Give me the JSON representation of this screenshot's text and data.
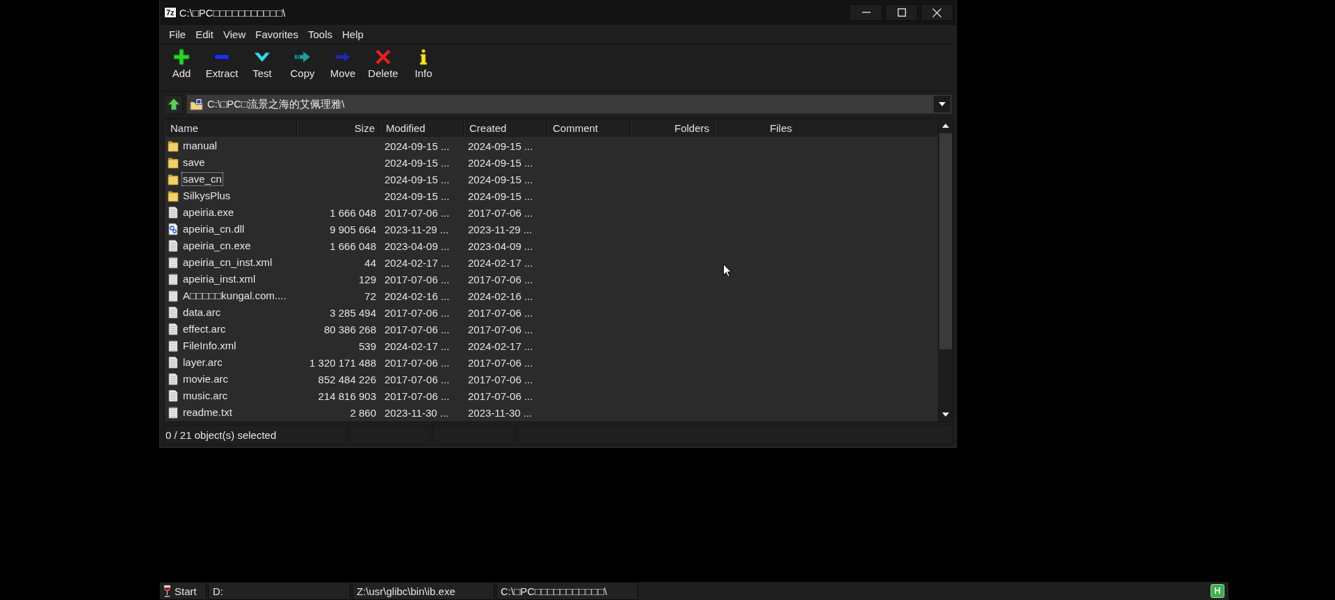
{
  "window": {
    "logo": "7z",
    "title": "C:\\□PC□□□□□□□□□□□\\"
  },
  "menu": [
    {
      "label": "File"
    },
    {
      "label": "Edit"
    },
    {
      "label": "View"
    },
    {
      "label": "Favorites"
    },
    {
      "label": "Tools"
    },
    {
      "label": "Help"
    }
  ],
  "toolbar": [
    {
      "kind": "add",
      "label": "Add"
    },
    {
      "kind": "extract",
      "label": "Extract"
    },
    {
      "kind": "test",
      "label": "Test"
    },
    {
      "kind": "copy",
      "label": "Copy"
    },
    {
      "kind": "move",
      "label": "Move"
    },
    {
      "kind": "delete",
      "label": "Delete"
    },
    {
      "kind": "info",
      "label": "Info"
    }
  ],
  "address_bar": {
    "path": "C:\\□PC□流景之海的艾佩理雅\\"
  },
  "file_list": {
    "columns": [
      {
        "label": "Name",
        "kind": "text"
      },
      {
        "label": "Size",
        "kind": "number"
      },
      {
        "label": "Modified",
        "kind": "text"
      },
      {
        "label": "Created",
        "kind": "text"
      },
      {
        "label": "Comment",
        "kind": "text"
      },
      {
        "label": "Folders",
        "kind": "number"
      },
      {
        "label": "Files",
        "kind": "number"
      }
    ],
    "rows": [
      {
        "kind": "folder",
        "name": "manual",
        "modified": "2024-09-15 ...",
        "created": "2024-09-15 ...",
        "selected": false,
        "focused": false
      },
      {
        "kind": "folder",
        "name": "save",
        "modified": "2024-09-15 ...",
        "created": "2024-09-15 ...",
        "selected": false,
        "focused": false
      },
      {
        "kind": "folder",
        "name": "save_cn",
        "modified": "2024-09-15 ...",
        "created": "2024-09-15 ...",
        "selected": false,
        "focused": true
      },
      {
        "kind": "folder",
        "name": "SilkysPlus",
        "modified": "2024-09-15 ...",
        "created": "2024-09-15 ...",
        "selected": false,
        "focused": false
      },
      {
        "kind": "file",
        "name": "apeiria.exe",
        "size": "1 666 048",
        "modified": "2017-07-06 ...",
        "created": "2017-07-06 ...",
        "selected": false,
        "focused": false
      },
      {
        "kind": "library",
        "name": "apeiria_cn.dll",
        "size": "9 905 664",
        "modified": "2023-11-29 ...",
        "created": "2023-11-29 ...",
        "selected": false,
        "focused": false
      },
      {
        "kind": "file",
        "name": "apeiria_cn.exe",
        "size": "1 666 048",
        "modified": "2023-04-09 ...",
        "created": "2023-04-09 ...",
        "selected": false,
        "focused": false
      },
      {
        "kind": "text",
        "name": "apeiria_cn_inst.xml",
        "size": "44",
        "modified": "2024-02-17 ...",
        "created": "2024-02-17 ...",
        "selected": false,
        "focused": false
      },
      {
        "kind": "text",
        "name": "apeiria_inst.xml",
        "size": "129",
        "modified": "2017-07-06 ...",
        "created": "2017-07-06 ...",
        "selected": false,
        "focused": false
      },
      {
        "kind": "text",
        "name": "A□□□□□kungal.com....",
        "size": "72",
        "modified": "2024-02-16 ...",
        "created": "2024-02-16 ...",
        "selected": false,
        "focused": false
      },
      {
        "kind": "file",
        "name": "data.arc",
        "size": "3 285 494",
        "modified": "2017-07-06 ...",
        "created": "2017-07-06 ...",
        "selected": false,
        "focused": false
      },
      {
        "kind": "file",
        "name": "effect.arc",
        "size": "80 386 268",
        "modified": "2017-07-06 ...",
        "created": "2017-07-06 ...",
        "selected": false,
        "focused": false
      },
      {
        "kind": "text",
        "name": "FileInfo.xml",
        "size": "539",
        "modified": "2024-02-17 ...",
        "created": "2024-02-17 ...",
        "selected": false,
        "focused": false
      },
      {
        "kind": "file",
        "name": "layer.arc",
        "size": "1 320 171 488",
        "modified": "2017-07-06 ...",
        "created": "2017-07-06 ...",
        "selected": false,
        "focused": false
      },
      {
        "kind": "file",
        "name": "movie.arc",
        "size": "852 484 226",
        "modified": "2017-07-06 ...",
        "created": "2017-07-06 ...",
        "selected": false,
        "focused": false
      },
      {
        "kind": "file",
        "name": "music.arc",
        "size": "214 816 903",
        "modified": "2017-07-06 ...",
        "created": "2017-07-06 ...",
        "selected": false,
        "focused": false
      },
      {
        "kind": "text",
        "name": "readme.txt",
        "size": "2 860",
        "modified": "2023-11-30 ...",
        "created": "2023-11-30 ...",
        "selected": false,
        "focused": false
      }
    ]
  },
  "status_bar": {
    "text": "0 / 21 object(s) selected"
  },
  "taskbar": {
    "start": "Start",
    "tasks": [
      {
        "label": "D:"
      },
      {
        "label": "Z:\\usr\\glibc\\bin\\ib.exe"
      },
      {
        "label": "C:\\□PC□□□□□□□□□□□\\"
      }
    ],
    "tray_badge": "H"
  }
}
